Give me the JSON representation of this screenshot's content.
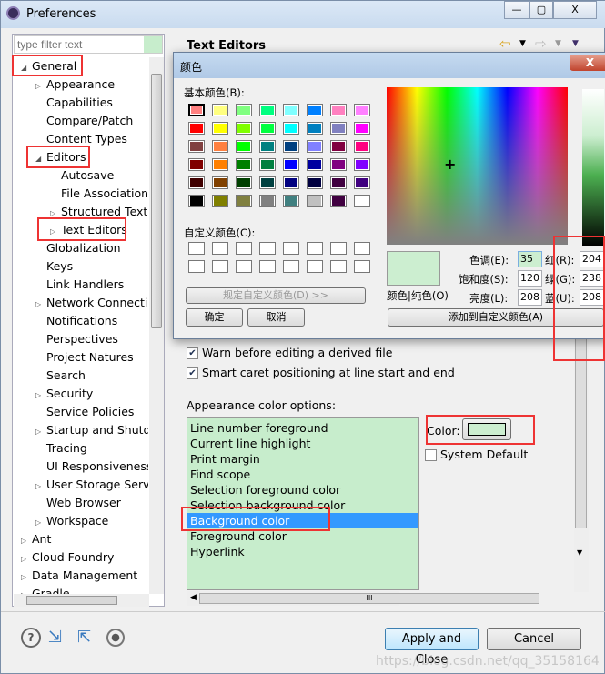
{
  "window": {
    "title": "Preferences",
    "min": "—",
    "max": "▢",
    "close": "X"
  },
  "filter": {
    "placeholder": "type filter text"
  },
  "tree": [
    {
      "label": "General",
      "level": 0,
      "toggle": "expanded"
    },
    {
      "label": "Appearance",
      "level": 1,
      "toggle": "collapsed"
    },
    {
      "label": "Capabilities",
      "level": 1,
      "toggle": ""
    },
    {
      "label": "Compare/Patch",
      "level": 1,
      "toggle": ""
    },
    {
      "label": "Content Types",
      "level": 1,
      "toggle": ""
    },
    {
      "label": "Editors",
      "level": 1,
      "toggle": "expanded"
    },
    {
      "label": "Autosave",
      "level": 2,
      "toggle": ""
    },
    {
      "label": "File Associations",
      "level": 2,
      "toggle": ""
    },
    {
      "label": "Structured Text E",
      "level": 2,
      "toggle": "collapsed"
    },
    {
      "label": "Text Editors",
      "level": 2,
      "toggle": "collapsed"
    },
    {
      "label": "Globalization",
      "level": 1,
      "toggle": ""
    },
    {
      "label": "Keys",
      "level": 1,
      "toggle": ""
    },
    {
      "label": "Link Handlers",
      "level": 1,
      "toggle": ""
    },
    {
      "label": "Network Connectio",
      "level": 1,
      "toggle": "collapsed"
    },
    {
      "label": "Notifications",
      "level": 1,
      "toggle": ""
    },
    {
      "label": "Perspectives",
      "level": 1,
      "toggle": ""
    },
    {
      "label": "Project Natures",
      "level": 1,
      "toggle": ""
    },
    {
      "label": "Search",
      "level": 1,
      "toggle": ""
    },
    {
      "label": "Security",
      "level": 1,
      "toggle": "collapsed"
    },
    {
      "label": "Service Policies",
      "level": 1,
      "toggle": ""
    },
    {
      "label": "Startup and Shutdo",
      "level": 1,
      "toggle": "collapsed"
    },
    {
      "label": "Tracing",
      "level": 1,
      "toggle": ""
    },
    {
      "label": "UI Responsiveness",
      "level": 1,
      "toggle": ""
    },
    {
      "label": "User Storage Servic",
      "level": 1,
      "toggle": "collapsed"
    },
    {
      "label": "Web Browser",
      "level": 1,
      "toggle": ""
    },
    {
      "label": "Workspace",
      "level": 1,
      "toggle": "collapsed"
    },
    {
      "label": "Ant",
      "level": 0,
      "toggle": "collapsed"
    },
    {
      "label": "Cloud Foundry",
      "level": 0,
      "toggle": "collapsed"
    },
    {
      "label": "Data Management",
      "level": 0,
      "toggle": "collapsed"
    },
    {
      "label": "Gradle",
      "level": 0,
      "toggle": "collapsed"
    }
  ],
  "page": {
    "title": "Text Editors",
    "checkboxes": [
      {
        "label": "Warn before editing a derived file",
        "checked": true
      },
      {
        "label": "Smart caret positioning at line start and end",
        "checked": true
      }
    ],
    "appearance_label": "Appearance color options:",
    "color_options": [
      "Line number foreground",
      "Current line highlight",
      "Print margin",
      "Find scope",
      "Selection foreground color",
      "Selection background color",
      "Background color",
      "Foreground color",
      "Hyperlink"
    ],
    "selected_option": "Background color",
    "color_label": "Color:",
    "color_value": "#cceed0",
    "system_default": {
      "label": "System Default",
      "checked": false
    },
    "scroll_grip": "III"
  },
  "buttons": {
    "apply_close": "Apply and Close",
    "cancel": "Cancel"
  },
  "color_dialog": {
    "title": "颜色",
    "close": "X",
    "basic_label": "基本颜色(B):",
    "basic_colors": [
      "#ff8080",
      "#ffff80",
      "#80ff80",
      "#00ff80",
      "#80ffff",
      "#0080ff",
      "#ff80c0",
      "#ff80ff",
      "#ff0000",
      "#ffff00",
      "#80ff00",
      "#00ff40",
      "#00ffff",
      "#0080c0",
      "#8080c0",
      "#ff00ff",
      "#804040",
      "#ff8040",
      "#00ff00",
      "#008080",
      "#004080",
      "#8080ff",
      "#800040",
      "#ff0080",
      "#800000",
      "#ff8000",
      "#008000",
      "#008040",
      "#0000ff",
      "#0000a0",
      "#800080",
      "#8000ff",
      "#400000",
      "#804000",
      "#004000",
      "#004040",
      "#000080",
      "#000040",
      "#400040",
      "#400080",
      "#000000",
      "#808000",
      "#808040",
      "#808080",
      "#408080",
      "#c0c0c0",
      "#400040",
      "#ffffff"
    ],
    "custom_label": "自定义颜色(C):",
    "define_custom": "规定自定义颜色(D) >>",
    "ok": "确定",
    "cancel": "取消",
    "solid_label": "颜色|纯色(O)",
    "hue_label": "色调(E):",
    "hue": "35",
    "sat_label": "饱和度(S):",
    "sat": "120",
    "lum_label": "亮度(L):",
    "lum": "208",
    "red_label": "红(R):",
    "red": "204",
    "green_label": "绿(G):",
    "green": "238",
    "blue_label": "蓝(U):",
    "blue": "208",
    "add_custom": "添加到自定义颜色(A)",
    "current_color": "#cceed0"
  },
  "watermark": "https://blog.csdn.net/qq_35158164"
}
